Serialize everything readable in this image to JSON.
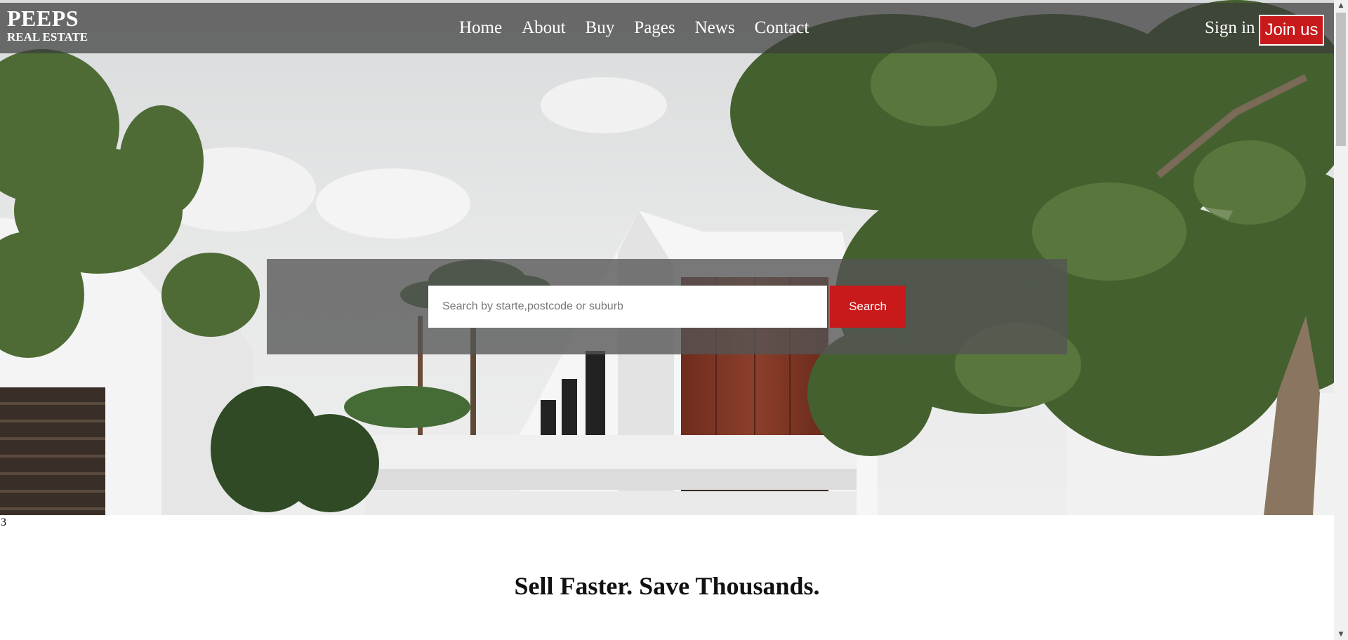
{
  "brand": {
    "title": "PEEPS",
    "subtitle": "REAL ESTATE"
  },
  "nav": {
    "items": [
      "Home",
      "About",
      "Buy",
      "Pages",
      "News",
      "Contact"
    ]
  },
  "header": {
    "sign_in": "Sign in",
    "join": "Join us"
  },
  "search": {
    "placeholder": "Search by starte,postcode or suburb",
    "button": "Search"
  },
  "stray_text": "3",
  "section": {
    "title": "Sell Faster. Save Thousands."
  },
  "colors": {
    "accent": "#c8191b",
    "header_bg": "#3c3c3c",
    "panel_bg": "#555555"
  },
  "icons": {
    "scroll_up": "triangle-up-icon",
    "scroll_down": "triangle-down-icon"
  }
}
